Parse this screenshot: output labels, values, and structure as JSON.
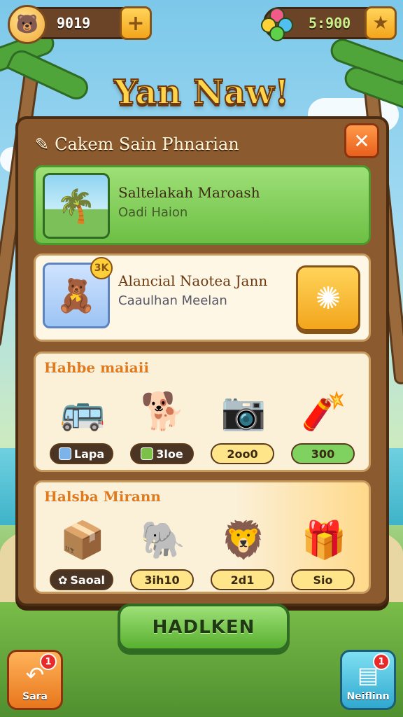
{
  "top_bar": {
    "coins_value": "9019",
    "coins_add_icon": "plus-icon",
    "gems_value": "5:900",
    "gems_action_icon": "star-icon"
  },
  "title": "Yan Naw!",
  "panel": {
    "header_icon": "pencil-icon",
    "header": "Cakem Sain Phnarian",
    "close_icon": "close-icon"
  },
  "featured_card": {
    "title": "Saltelakah Maroash",
    "subtitle": "Oadi Haion"
  },
  "quest_card": {
    "badge": "3K",
    "title": "Alancial Naotea Jann",
    "subtitle": "Caaulhan Meelan",
    "action_icon": "sun-burst-icon"
  },
  "section_1": {
    "title": "Hahbe maiaii",
    "items": [
      {
        "art": "bus",
        "label": "Lapa"
      },
      {
        "art": "dog",
        "label": "3loe"
      },
      {
        "art": "camera",
        "label": "2oo0"
      },
      {
        "art": "firecracker",
        "label": "300"
      }
    ]
  },
  "section_2": {
    "title": "Halsba Mirann",
    "items": [
      {
        "art": "crates",
        "label": "Saoal"
      },
      {
        "art": "elephant",
        "label": "3ih10"
      },
      {
        "art": "lion-cub",
        "label": "2d1"
      },
      {
        "art": "treasure-box",
        "label": "Sio"
      }
    ]
  },
  "main_button": "HADLKEN",
  "bottom_left": {
    "label": "Sara",
    "badge": "1"
  },
  "bottom_right": {
    "label": "Neiflinn",
    "badge": "1"
  },
  "colors": {
    "panel_wood": "#8b5a2f",
    "accent_green": "#6dbf45",
    "accent_gold": "#f3a51c",
    "title_gold": "#ffd34a"
  }
}
